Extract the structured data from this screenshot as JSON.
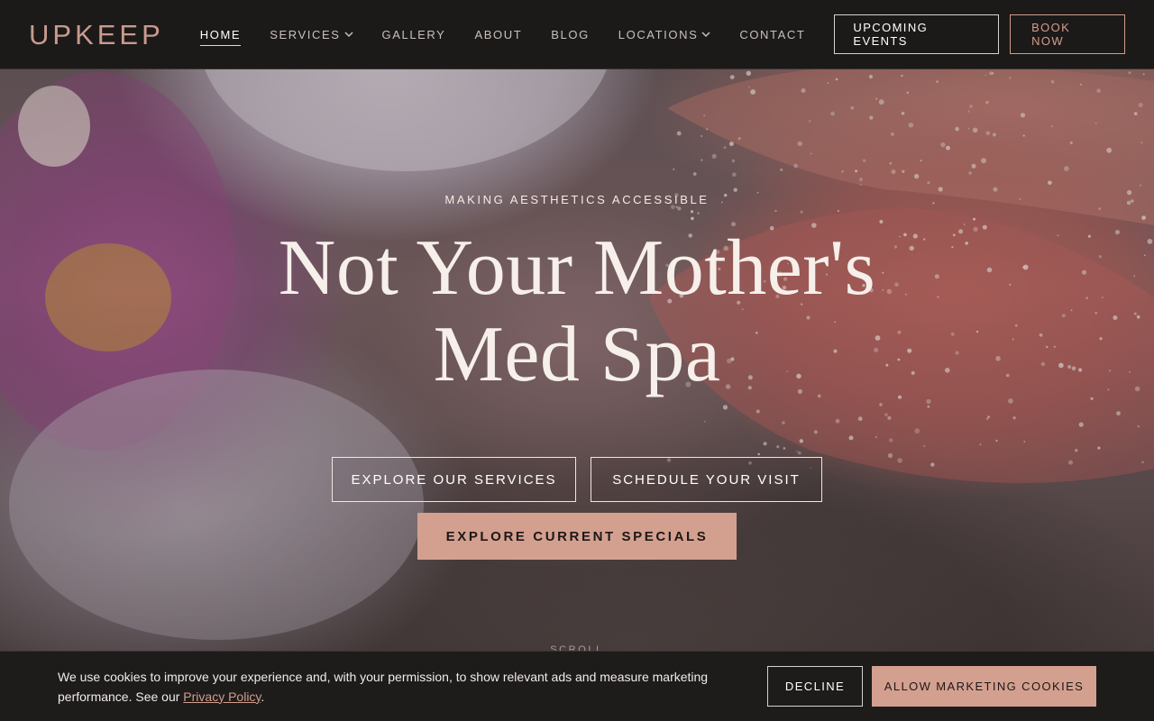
{
  "brand": {
    "logo_text": "UPKEEP"
  },
  "nav": {
    "items": [
      {
        "label": "HOME",
        "active": true,
        "dropdown": false
      },
      {
        "label": "SERVICES",
        "active": false,
        "dropdown": true
      },
      {
        "label": "GALLERY",
        "active": false,
        "dropdown": false
      },
      {
        "label": "ABOUT",
        "active": false,
        "dropdown": false
      },
      {
        "label": "BLOG",
        "active": false,
        "dropdown": false
      },
      {
        "label": "LOCATIONS",
        "active": false,
        "dropdown": true
      },
      {
        "label": "CONTACT",
        "active": false,
        "dropdown": false
      }
    ],
    "upcoming_events_label": "UPCOMING EVENTS",
    "book_now_label": "BOOK NOW"
  },
  "hero": {
    "eyebrow": "MAKING AESTHETICS ACCESSIBLE",
    "headline_line1": "Not Your Mother's",
    "headline_line2": "Med Spa",
    "cta_services": "EXPLORE OUR SERVICES",
    "cta_schedule": "SCHEDULE YOUR VISIT",
    "cta_specials": "EXPLORE CURRENT SPECIALS",
    "scroll_label": "SCROLL"
  },
  "cookie_banner": {
    "text_before_link": "We use cookies to improve your experience and, with your permission, to show relevant ads and measure marketing performance. See our ",
    "link_text": "Privacy Policy",
    "text_after_link": ".",
    "decline_label": "DECLINE",
    "allow_label": "ALLOW MARKETING COOKIES"
  },
  "colors": {
    "accent": "#d3a090",
    "logo": "#c99a8e",
    "header_bg": "#1c1a19"
  }
}
